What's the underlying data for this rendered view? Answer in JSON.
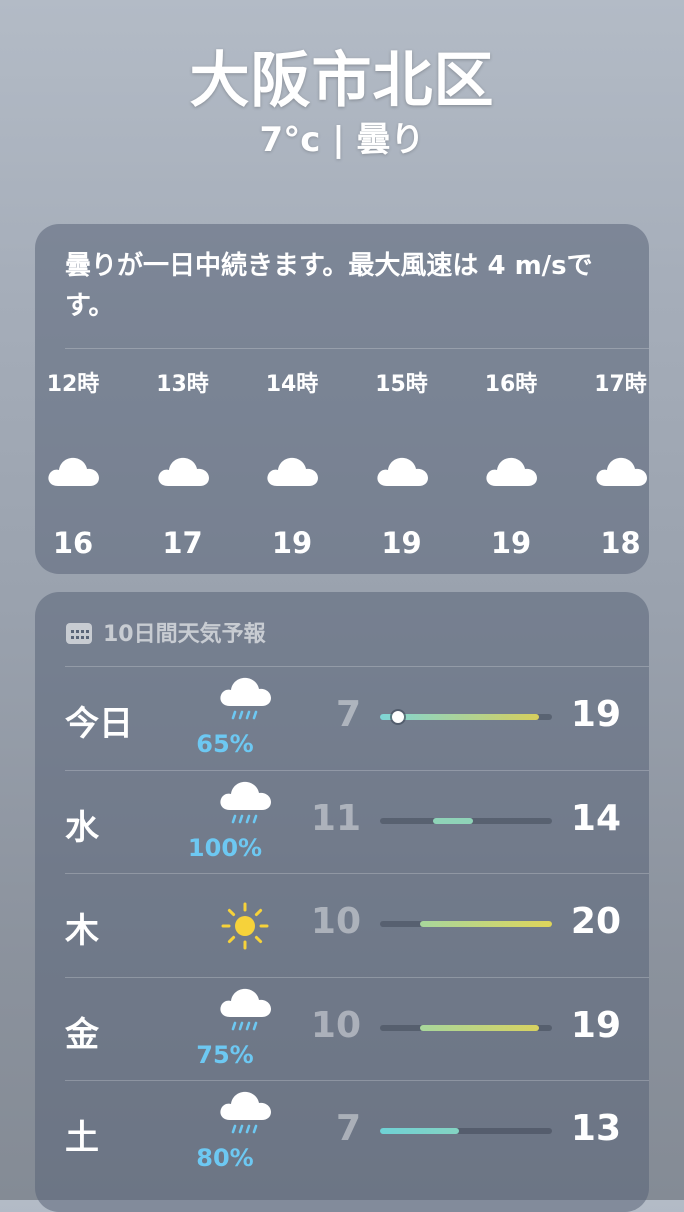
{
  "header": {
    "city": "大阪市北区",
    "condition": "7°c | 曇り"
  },
  "hourly": {
    "summary": "曇りが一日中続きます。最大風速は 4 m/sです。",
    "hours": [
      {
        "time": "12時",
        "icon": "cloud-icon",
        "temp": "16"
      },
      {
        "time": "13時",
        "icon": "cloud-icon",
        "temp": "17"
      },
      {
        "time": "14時",
        "icon": "cloud-icon",
        "temp": "19"
      },
      {
        "time": "15時",
        "icon": "cloud-icon",
        "temp": "19"
      },
      {
        "time": "16時",
        "icon": "cloud-icon",
        "temp": "19"
      },
      {
        "time": "17時",
        "icon": "cloud-icon",
        "temp": "18"
      }
    ]
  },
  "forecast": {
    "title": "10日間天気予報",
    "range_low": 7,
    "range_high": 20,
    "days": [
      {
        "day": "今日",
        "icon": "cloud-rain-icon",
        "precip": "65%",
        "low": "7",
        "high": "19",
        "current": 7,
        "colors": [
          "#7fd6d7",
          "#d7cf5c"
        ]
      },
      {
        "day": "水",
        "icon": "cloud-rain-icon",
        "precip": "100%",
        "low": "11",
        "high": "14",
        "colors": [
          "#8fd3b8",
          "#8fd3b8"
        ]
      },
      {
        "day": "木",
        "icon": "sun-icon",
        "precip": "",
        "low": "10",
        "high": "20",
        "colors": [
          "#a8d79c",
          "#dfd55a"
        ]
      },
      {
        "day": "金",
        "icon": "cloud-rain-icon",
        "precip": "75%",
        "low": "10",
        "high": "19",
        "colors": [
          "#a8d79c",
          "#d8d260"
        ]
      },
      {
        "day": "土",
        "icon": "cloud-rain-icon",
        "precip": "80%",
        "low": "7",
        "high": "13",
        "colors": [
          "#6fd2d6",
          "#84d3c2"
        ]
      }
    ]
  }
}
